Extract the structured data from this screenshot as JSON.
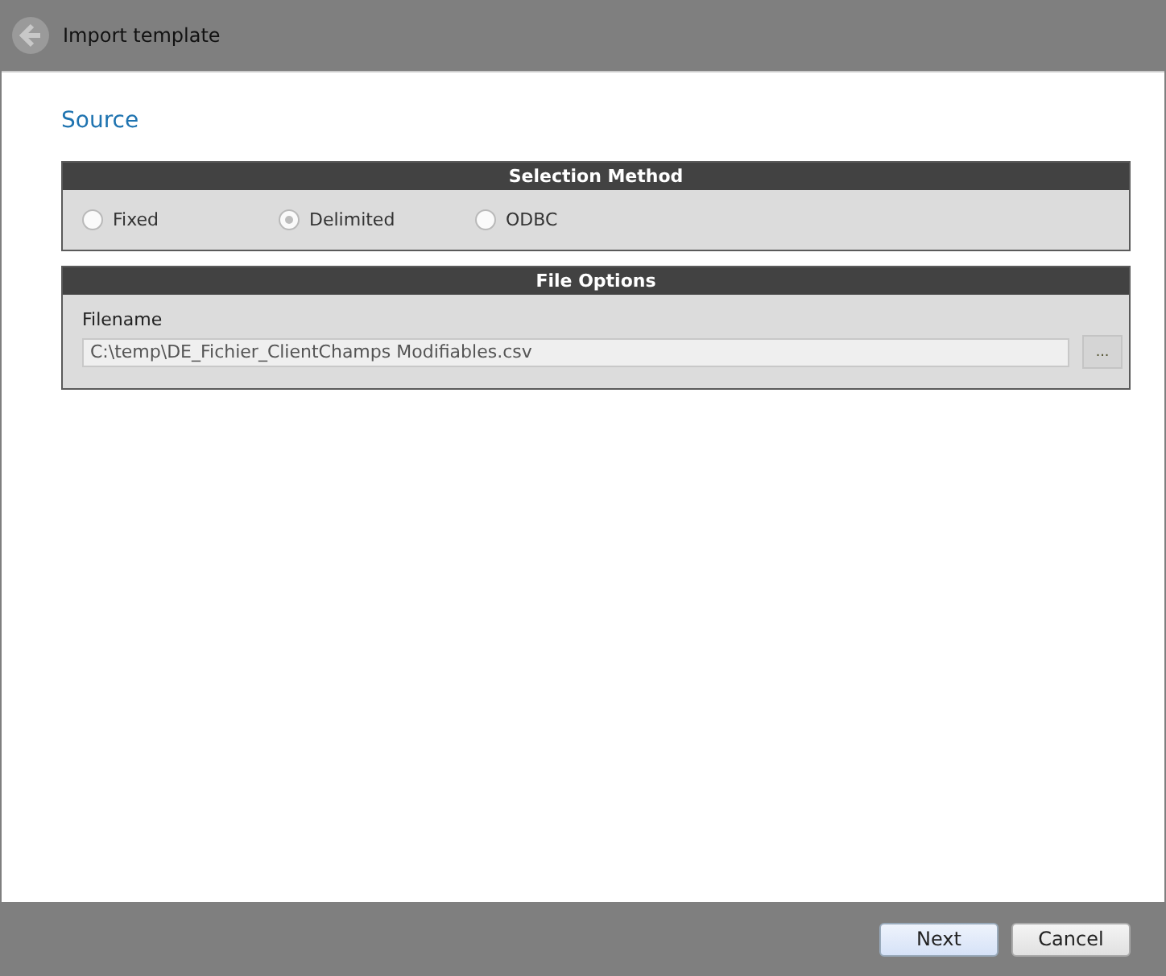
{
  "window": {
    "title": "Import template"
  },
  "page_title": "Source",
  "selection_method": {
    "title": "Selection Method",
    "options": [
      {
        "label": "Fixed",
        "selected": false
      },
      {
        "label": "Delimited",
        "selected": true
      },
      {
        "label": "ODBC",
        "selected": false
      }
    ]
  },
  "file_options": {
    "title": "File Options",
    "filename_label": "Filename",
    "filename_value": "C:\\temp\\DE_Fichier_ClientChamps Modifiables.csv",
    "browse_button": "..."
  },
  "buttons": [
    {
      "label": "Next",
      "kind": "primary"
    },
    {
      "label": "Cancel",
      "kind": "normal"
    }
  ]
}
